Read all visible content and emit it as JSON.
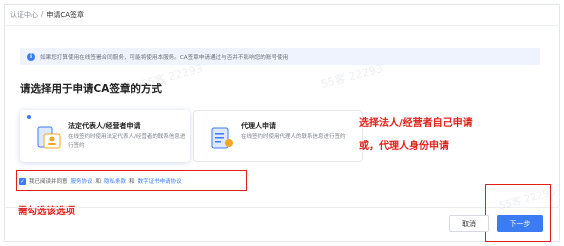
{
  "breadcrumb": {
    "parent": "认证中心",
    "sep": "/",
    "current": "申请CA签章"
  },
  "notice": {
    "icon": "info-icon",
    "text": "如果您打算使用在线签署合同服务，可能将使用本服务。CA签章申请通过与否并不影响您的账号使用"
  },
  "section_title": "请选择用于申请CA签章的方式",
  "cards": [
    {
      "title": "法定代表人/经营者申请",
      "desc": "在线签约时使用法定代表人/经营者的联系信息进行签约",
      "icon": "legal-person-card-icon",
      "selected": true
    },
    {
      "title": "代理人申请",
      "desc": "在线签约时使用代理人的联系信息进行签约",
      "icon": "agent-document-icon",
      "selected": false
    }
  ],
  "agreement": {
    "checked": true,
    "prefix": "我已阅读并同意",
    "link1": "服务协议",
    "and1": "和",
    "link2": "隐私条款",
    "and2": "和",
    "link3": "数字证书申请协议"
  },
  "annotations": {
    "line1": "选择法人/经营者自己申请",
    "line2": "或，代理人身份申请",
    "check_hint": "需勾选该选项"
  },
  "buttons": {
    "cancel": "取消",
    "next": "下一步"
  },
  "watermark": "55客 22293",
  "colors": {
    "accent": "#3b7cf5",
    "annotation": "#e0211b"
  }
}
